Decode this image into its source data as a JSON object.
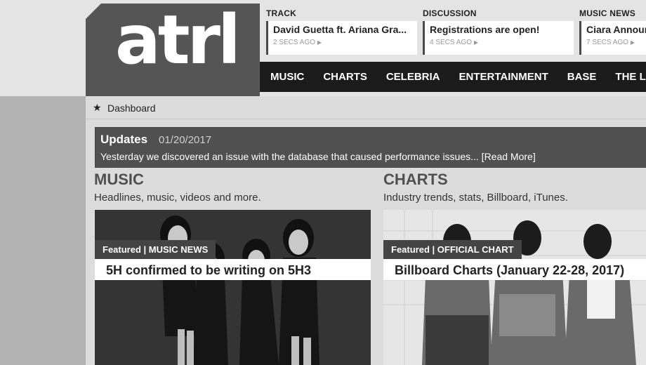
{
  "brand": {
    "logo_text": "atrl"
  },
  "tickers": [
    {
      "category": "TRACK",
      "headline": "David Guetta ft. Ariana Gra...",
      "time": "2 SECS AGO"
    },
    {
      "category": "DISCUSSION",
      "headline": "Registrations are open!",
      "time": "4 SECS AGO"
    },
    {
      "category": "MUSIC NEWS",
      "headline": "Ciara Announ",
      "time": "7 SECS AGO"
    }
  ],
  "nav": {
    "items": [
      "MUSIC",
      "CHARTS",
      "CELEBRIA",
      "ENTERTAINMENT",
      "BASE",
      "THE LOU"
    ]
  },
  "breadcrumb": {
    "label": "Dashboard"
  },
  "updates": {
    "title": "Updates",
    "date": "01/20/2017",
    "message": "Yesterday we discovered an issue with the database that caused performance issues... [Read More]"
  },
  "sections": [
    {
      "heading": "MUSIC",
      "subtitle": "Headlines, music, videos and more.",
      "tag": "Featured | MUSIC NEWS",
      "caption": "5H confirmed to be writing on 5H3"
    },
    {
      "heading": "CHARTS",
      "subtitle": "Industry trends, stats, Billboard, iTunes.",
      "tag": "Featured | OFFICIAL CHART",
      "caption": "Billboard Charts (January 22-28, 2017)"
    }
  ]
}
